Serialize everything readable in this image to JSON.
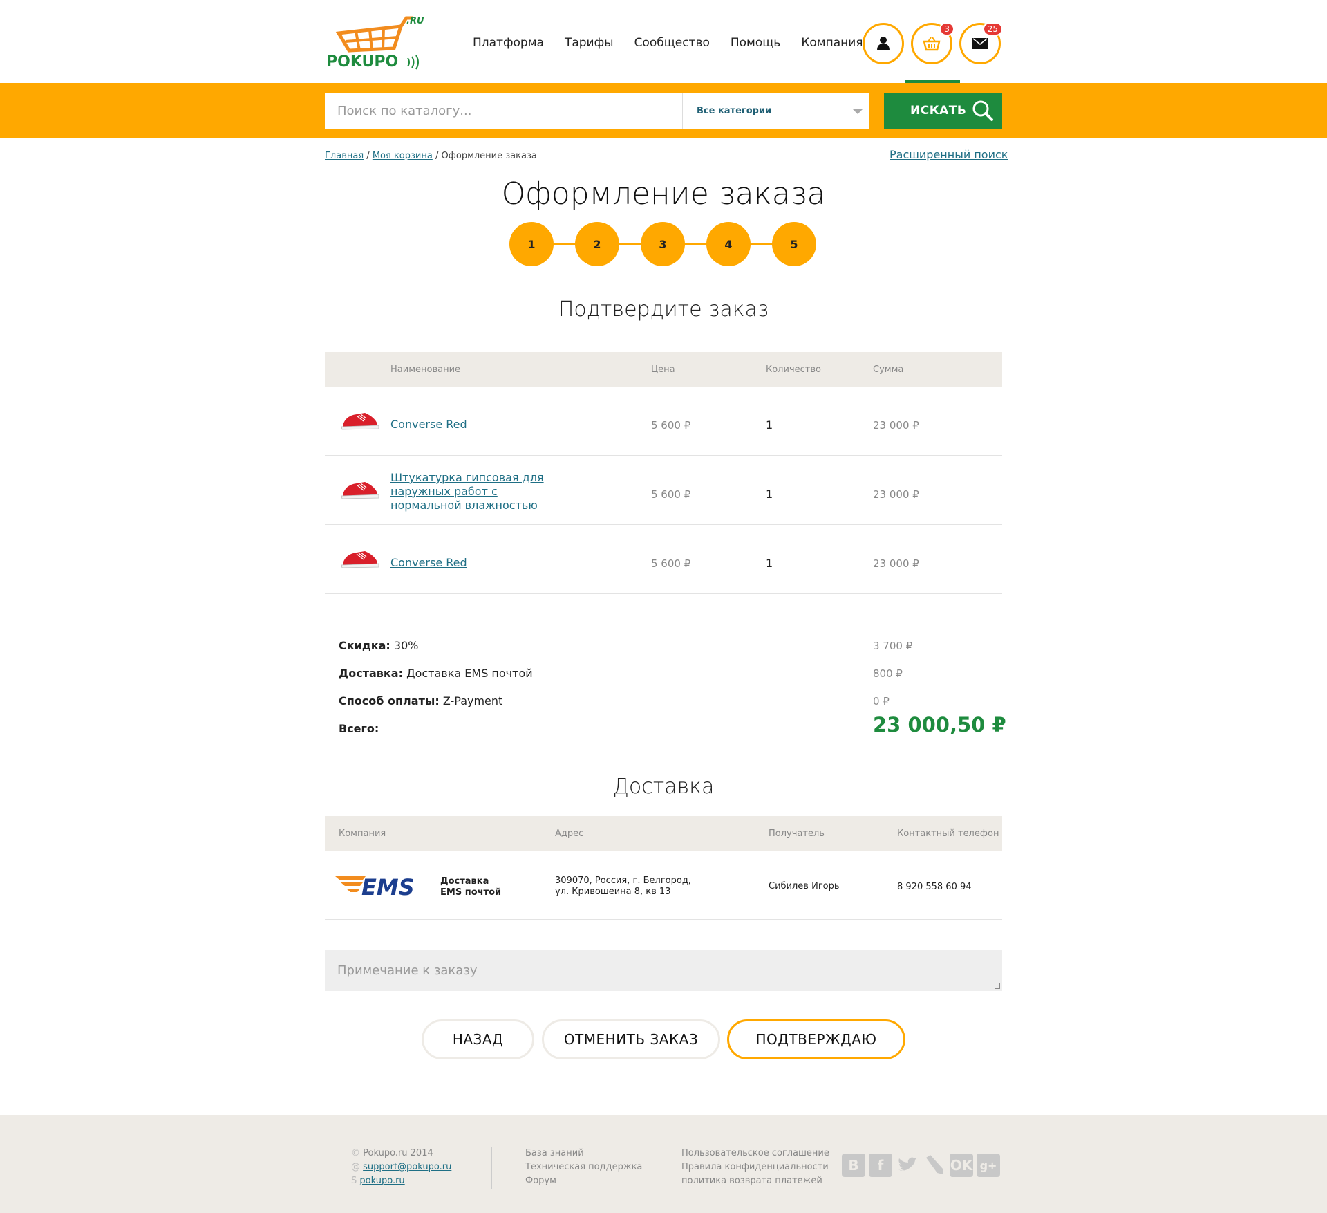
{
  "header": {
    "logo_text": "POKUPO",
    "logo_suffix": ".RU",
    "nav": [
      "Платформа",
      "Тарифы",
      "Сообщество",
      "Помощь",
      "Компания"
    ],
    "cart_badge": "3",
    "mail_badge": "25"
  },
  "search": {
    "placeholder": "Поиск по каталогу...",
    "category": "Все категории",
    "button": "ИСКАТЬ"
  },
  "breadcrumb": {
    "home": "Главная",
    "cart": "Моя корзина",
    "sep": "/",
    "current": "Оформление заказа"
  },
  "advanced_search": "Расширенный поиск",
  "page_title": "Оформление заказа",
  "steps": [
    "1",
    "2",
    "3",
    "4",
    "5"
  ],
  "confirm_title": "Подтвердите заказ",
  "order_table": {
    "headers": {
      "name": "Наименование",
      "price": "Цена",
      "qty": "Количество",
      "sum": "Сумма"
    },
    "rows": [
      {
        "name": "Converse Red",
        "price": "5 600 ₽",
        "qty": "1",
        "sum": "23 000 ₽"
      },
      {
        "name": "Штукатурка гипсовая для наружных работ с нормальной влажностью",
        "price": "5 600 ₽",
        "qty": "1",
        "sum": "23 000 ₽"
      },
      {
        "name": "Converse Red",
        "price": "5 600 ₽",
        "qty": "1",
        "sum": "23 000 ₽"
      }
    ]
  },
  "summary": {
    "discount_label": "Скидка:",
    "discount_value": "30%",
    "discount_amount": "3 700 ₽",
    "delivery_label": "Доставка:",
    "delivery_value": "Доставка EMS почтой",
    "delivery_amount": "800 ₽",
    "payment_label": "Способ оплаты:",
    "payment_value": "Z-Payment",
    "payment_amount": "0 ₽",
    "total_label": "Всего:",
    "total_amount": "23 000,50 ₽"
  },
  "delivery": {
    "title": "Доставка",
    "headers": {
      "company": "Компания",
      "address": "Адрес",
      "recipient": "Получатель",
      "phone": "Контактный телефон"
    },
    "logo_text": "EMS",
    "company_line1": "Доставка",
    "company_line2": "EMS почтой",
    "address_line1": "309070, Россия, г. Белгород,",
    "address_line2": "ул. Кривошеина 8, кв 13",
    "recipient": "Сибилев Игорь",
    "phone": "8 920 558 60 94"
  },
  "note_placeholder": "Примечание к заказу",
  "buttons": {
    "back": "НАЗАД",
    "cancel": "ОТМЕНИТЬ ЗАКАЗ",
    "confirm": "ПОДТВЕРЖДАЮ"
  },
  "footer": {
    "copyright": "Pokupo.ru 2014",
    "email": "support@pokupo.ru",
    "skype": "pokupo.ru",
    "links1": [
      "База знаний",
      "Техническая поддержка",
      "Форум"
    ],
    "links2": [
      "Пользовательское соглашение",
      "Правила конфиденциальности",
      "политика возврата платежей"
    ],
    "social": [
      "vk",
      "facebook",
      "twitter",
      "livejournal",
      "odnoklassniki",
      "google-plus"
    ]
  },
  "colors": {
    "accent": "#ffa800",
    "green": "#1e8b3e",
    "link": "#1f6f85",
    "panel": "#eeebe6"
  }
}
